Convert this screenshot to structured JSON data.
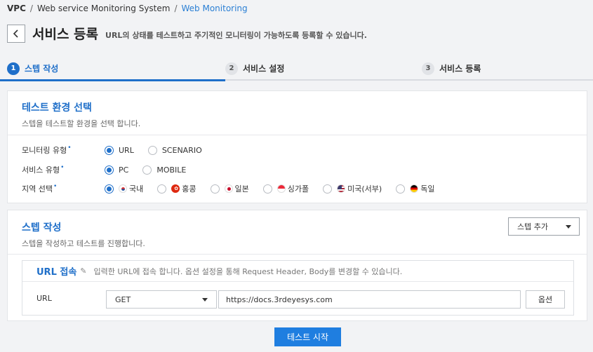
{
  "breadcrumb": {
    "root": "VPC",
    "level1": "Web service Monitoring System",
    "current": "Web Monitoring",
    "sep": "/"
  },
  "header": {
    "title": "서비스 등록",
    "description": "URL의 상태를 테스트하고 주기적인 모니터링이 가능하도록 등록할 수 있습니다."
  },
  "steps": [
    {
      "num": "1",
      "label": "스텝 작성"
    },
    {
      "num": "2",
      "label": "서비스 설정"
    },
    {
      "num": "3",
      "label": "서비스 등록"
    }
  ],
  "env": {
    "title": "테스트 환경 선택",
    "subtitle": "스텝을 테스트할 환경을 선택 합니다.",
    "monitor_type": {
      "label": "모니터링 유형",
      "options": [
        "URL",
        "SCENARIO"
      ],
      "selected": "URL"
    },
    "service_type": {
      "label": "서비스 유형",
      "options": [
        "PC",
        "MOBILE"
      ],
      "selected": "PC"
    },
    "region": {
      "label": "지역 선택",
      "options": [
        "국내",
        "홍콩",
        "일본",
        "싱가폴",
        "미국(서부)",
        "독일"
      ],
      "selected": "국내"
    },
    "required_mark": "•"
  },
  "step_section": {
    "title": "스텝 작성",
    "subtitle": "스텝을 작성하고 테스트를 진행합니다.",
    "add_step_label": "스텝 추가"
  },
  "url_step": {
    "title": "URL 접속",
    "description": "입력한 URL에 접속 합니다. 옵션 설정을 통해 Request Header, Body를 변경할 수 있습니다.",
    "url_label": "URL",
    "method": "GET",
    "url_value": "https://docs.3rdeyesys.com",
    "option_label": "옵션"
  },
  "start_test_label": "테스트 시작",
  "colors": {
    "accent": "#1f6fc9",
    "button": "#1f7ee0"
  }
}
